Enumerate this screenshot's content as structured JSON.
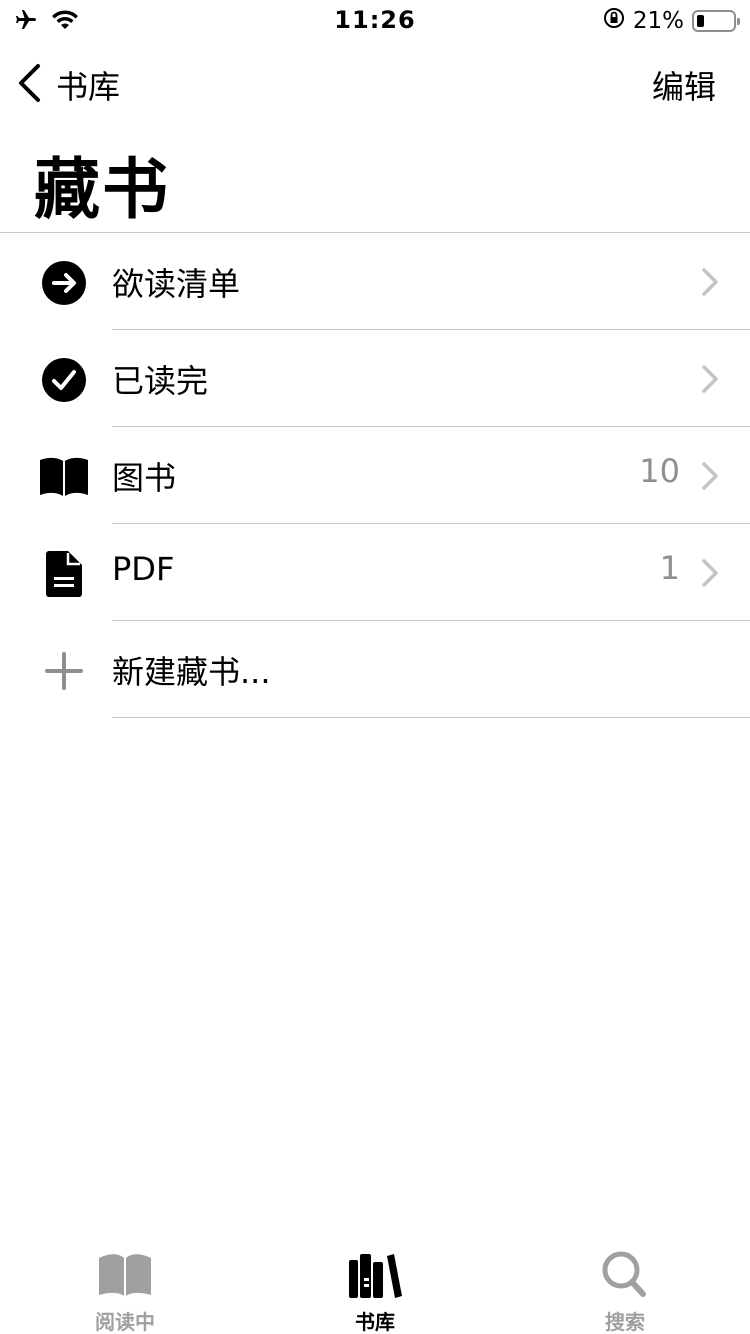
{
  "status_bar": {
    "time": "11:26",
    "battery_percent": "21%",
    "battery_level": 0.21,
    "icons": [
      "airplane-icon",
      "wifi-icon",
      "orientation-lock-icon",
      "battery-icon"
    ]
  },
  "nav": {
    "back_label": "书库",
    "edit_label": "编辑"
  },
  "page": {
    "title": "藏书"
  },
  "collections": [
    {
      "label": "欲读清单",
      "count": "",
      "icon": "arrow-circle-icon"
    },
    {
      "label": "已读完",
      "count": "",
      "icon": "checkmark-circle-icon"
    },
    {
      "label": "图书",
      "count": "10",
      "icon": "book-icon"
    },
    {
      "label": "PDF",
      "count": "1",
      "icon": "document-icon"
    },
    {
      "label": "新建藏书...",
      "count": "",
      "icon": "plus-icon"
    }
  ],
  "tab_bar": {
    "tabs": [
      {
        "label": "阅读中",
        "icon": "book-open-icon",
        "active": false
      },
      {
        "label": "书库",
        "icon": "library-icon",
        "active": true
      },
      {
        "label": "搜索",
        "icon": "search-icon",
        "active": false
      }
    ]
  },
  "colors": {
    "separator": "#c8c7cc",
    "secondary_text": "#8e8e93",
    "inactive_tab": "#a0a0a0"
  }
}
